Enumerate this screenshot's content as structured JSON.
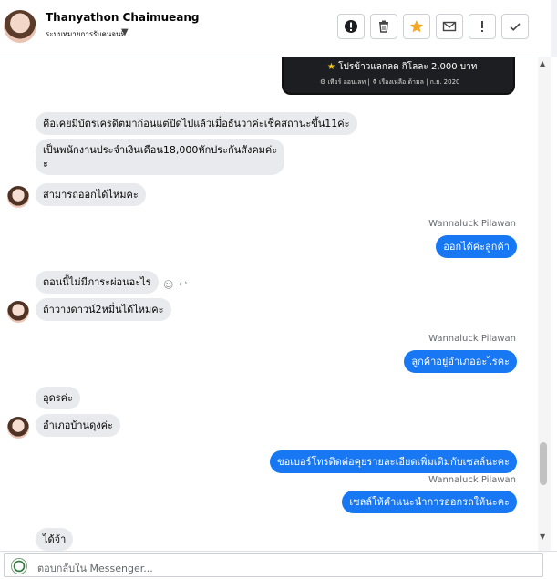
{
  "header": {
    "name": "Thanyathon Chaimueang",
    "sub": "ระบบหมายการรับคนจนที่"
  },
  "actions": [
    {
      "name": "report-icon"
    },
    {
      "name": "trash-icon"
    },
    {
      "name": "star-icon"
    },
    {
      "name": "mail-icon"
    },
    {
      "name": "exclamation-icon"
    },
    {
      "name": "check-icon"
    }
  ],
  "card": {
    "line1": "โปรข้าวแลกลด กิโลละ 2,000 บาท",
    "line2": "⚙ เทียร์ ออนเลท  |  ⚱ เรื่องเหลือ ด้ามล  |  ก.ย. 2020"
  },
  "messages": {
    "m1": "คือเคยมีบัตรเครดิตมาก่อนแต่ปิดไปแล้วเมื่อธันวาค่ะเช็คสถานะขึ้น11ค่ะ",
    "m2_l1": "เป็นพนักงานประจำเงินเดือน18,000หักประกันสังคมค่ะ",
    "m2_l2": "ะ",
    "m3": "สามารถออกได้ไหมคะ",
    "s1": "Wannaluck Pilawan",
    "o1": "ออกได้ค่ะลูกค้า",
    "m4": "ตอนนี้ไม่มีภาระผ่อนอะไร",
    "m5": "ถ้าวางดาวน์2หมื่นได้ไหมคะ",
    "s2": "Wannaluck Pilawan",
    "o2": "ลูกค้าอยู่อำเภออะไรคะ",
    "m6": "อุดรค่ะ",
    "m7": "อำเภอบ้านดุงค่ะ",
    "o3": "ขอเบอร์โทรติดต่อคุยรายละเอียดเพิ่มเติมกับเซลล์นะคะ",
    "s3": "Wannaluck Pilawan",
    "o4": "เซลล์ให้คำแนะนำการออกรถให้นะคะ",
    "m8": "ได้จ้า"
  },
  "composer": {
    "placeholder": "ตอบกลับใน Messenger..."
  }
}
